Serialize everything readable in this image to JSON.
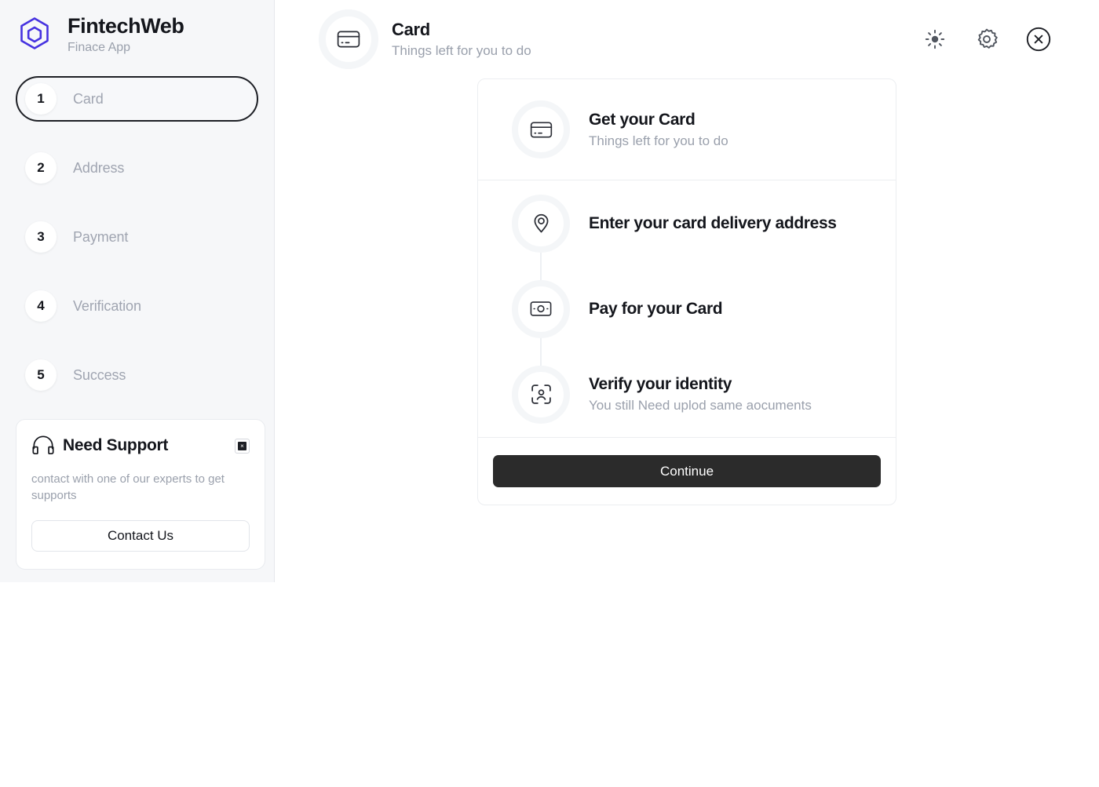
{
  "brand": {
    "name": "FintechWeb",
    "tagline": "Finace App",
    "logo_icon": "hexagon-logo-icon",
    "logo_color": "#4632e0"
  },
  "sidebar": {
    "steps": [
      {
        "number": "1",
        "label": "Card",
        "active": true
      },
      {
        "number": "2",
        "label": "Address",
        "active": false
      },
      {
        "number": "3",
        "label": "Payment",
        "active": false
      },
      {
        "number": "4",
        "label": "Verification",
        "active": false
      },
      {
        "number": "5",
        "label": "Success",
        "active": false
      }
    ],
    "support": {
      "icon": "headphones-icon",
      "title": "Need Support",
      "close_icon": "close-icon",
      "body": "contact with one of our experts to get supports",
      "button_label": "Contact Us"
    }
  },
  "header": {
    "icon": "credit-card-icon",
    "title": "Card",
    "subtitle": "Things left for you to do",
    "actions": [
      {
        "name": "theme-toggle",
        "icon": "sun-icon"
      },
      {
        "name": "settings",
        "icon": "gear-icon"
      },
      {
        "name": "close",
        "icon": "close-circle-icon"
      }
    ]
  },
  "panel": {
    "items": [
      {
        "icon": "credit-card-icon",
        "title": "Get your Card",
        "subtitle": "Things left for you to do"
      },
      {
        "icon": "map-pin-icon",
        "title": "Enter your card delivery address",
        "subtitle": ""
      },
      {
        "icon": "banknote-icon",
        "title": "Pay for your Card",
        "subtitle": ""
      },
      {
        "icon": "face-scan-icon",
        "title": "Verify your identity",
        "subtitle": "You still Need uplod same aocuments"
      }
    ],
    "continue_label": "Continue"
  },
  "colors": {
    "accent": "#4632e0",
    "text_primary": "#14161c",
    "text_muted": "#9aa0ac",
    "sidebar_bg": "#f6f7f9",
    "button_dark": "#2b2b2b",
    "border": "#eceef1"
  }
}
